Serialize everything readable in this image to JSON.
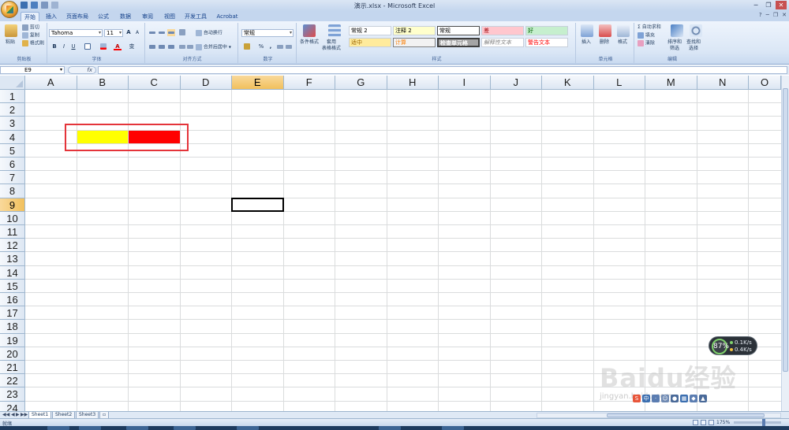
{
  "window": {
    "title": "演示.xlsx - Microsoft Excel",
    "minimize": "─",
    "restore": "❐",
    "close": "✕",
    "ribbon_minimize": "─",
    "ribbon_restore": "❐",
    "ribbon_close": "✕",
    "help": "?"
  },
  "tabs": [
    {
      "label": "开始",
      "active": true
    },
    {
      "label": "插入"
    },
    {
      "label": "页面布局"
    },
    {
      "label": "公式"
    },
    {
      "label": "数据"
    },
    {
      "label": "审阅"
    },
    {
      "label": "视图"
    },
    {
      "label": "开发工具"
    },
    {
      "label": "Acrobat"
    }
  ],
  "ribbon": {
    "clipboard": {
      "caption": "剪贴板",
      "paste": "粘贴",
      "cut": "剪切",
      "copy": "复制",
      "format_painter": "格式刷"
    },
    "font": {
      "caption": "字体",
      "name": "Tahoma",
      "size": "11",
      "bold": "B",
      "italic": "I",
      "underline": "U",
      "grow": "A",
      "shrink": "A",
      "font_color": "A",
      "wen": "变"
    },
    "alignment": {
      "caption": "对齐方式",
      "wrap": "自动换行",
      "merge": "合并后居中"
    },
    "number": {
      "caption": "数字",
      "format": "常规",
      "currency": "%",
      "comma": ","
    },
    "styles": {
      "caption": "样式",
      "conditional": "条件格式",
      "table": "套用\n表格格式",
      "cells": [
        {
          "text": "常规 2",
          "bg": "#ffffff",
          "color": "#000000"
        },
        {
          "text": "注释 2",
          "bg": "#ffffcc",
          "color": "#000000"
        },
        {
          "text": "常规",
          "bg": "#ffffff",
          "color": "#000000"
        },
        {
          "text": "差",
          "bg": "#ffc7ce",
          "color": "#9c0006"
        },
        {
          "text": "好",
          "bg": "#c6efce",
          "color": "#006100"
        },
        {
          "text": "适中",
          "bg": "#ffeb9c",
          "color": "#9c6500"
        },
        {
          "text": "计算",
          "bg": "#f2f2f2",
          "color": "#fa7d00"
        },
        {
          "text": "检查单元格",
          "bg": "#a5a5a5",
          "color": "#ffffff"
        },
        {
          "text": "解释性文本",
          "bg": "#ffffff",
          "color": "#7f7f7f"
        },
        {
          "text": "警告文本",
          "bg": "#ffffff",
          "color": "#ff0000"
        }
      ]
    },
    "cells_group": {
      "caption": "单元格",
      "insert": "插入",
      "delete": "删除",
      "format": "格式"
    },
    "editing": {
      "caption": "编辑",
      "autosum": "自动求和",
      "fill": "填充",
      "clear": "清除",
      "sort": "排序和\n筛选",
      "find": "查找和\n选择"
    }
  },
  "formula_bar": {
    "name_box": "E9",
    "fx": "fx",
    "content": ""
  },
  "grid": {
    "columns": [
      "A",
      "B",
      "C",
      "D",
      "E",
      "F",
      "G",
      "H",
      "I",
      "J",
      "K",
      "L",
      "M",
      "N",
      "O"
    ],
    "rows": [
      "1",
      "2",
      "3",
      "4",
      "5",
      "6",
      "7",
      "8",
      "9",
      "10",
      "11",
      "12",
      "13",
      "14",
      "15",
      "16",
      "17",
      "18",
      "19",
      "20",
      "21",
      "22",
      "23",
      "24"
    ],
    "selected_col": "E",
    "selected_row": "9",
    "fills": [
      {
        "cell": "B4",
        "color": "#ffff00"
      },
      {
        "cell": "C4",
        "color": "#ff0000"
      }
    ],
    "highlight_color": "#e4343a"
  },
  "overlay": {
    "speed_percent": "87%",
    "speed_up": "0.1K/s",
    "speed_down": "0.4K/s",
    "watermark": "Baidu经验",
    "watermark_sub": "jingyan.baidu.com"
  },
  "sheet_tabs": [
    {
      "label": "Sheet1",
      "active": true
    },
    {
      "label": "Sheet2"
    },
    {
      "label": "Sheet3"
    }
  ],
  "status": {
    "ready": "就绪",
    "zoom": "175%"
  }
}
